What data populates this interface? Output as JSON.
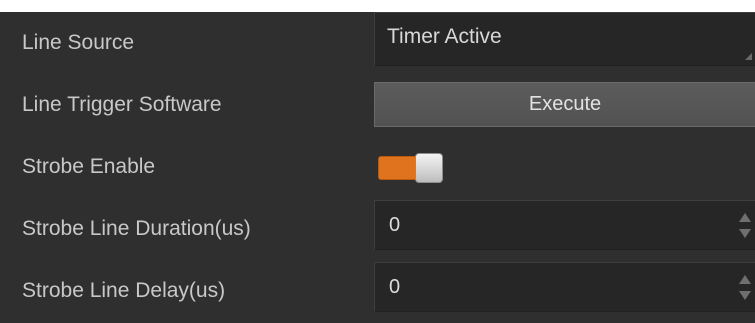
{
  "properties": {
    "line_source": {
      "label": "Line Source",
      "value": "Timer Active"
    },
    "line_trigger_software": {
      "label": "Line Trigger Software",
      "button_label": "Execute"
    },
    "strobe_enable": {
      "label": "Strobe Enable",
      "enabled": true
    },
    "strobe_line_duration": {
      "label": "Strobe Line Duration(us)",
      "value": "0"
    },
    "strobe_line_delay": {
      "label": "Strobe Line Delay(us)",
      "value": "0"
    }
  },
  "colors": {
    "panel_background": "#2f2f2f",
    "toggle_on": "#e0731e",
    "label_text": "#c8c8c8"
  },
  "icons": {
    "dropdown": "dropdown-corner-icon",
    "spin_up": "spin-up-arrow-icon",
    "spin_down": "spin-down-arrow-icon"
  }
}
